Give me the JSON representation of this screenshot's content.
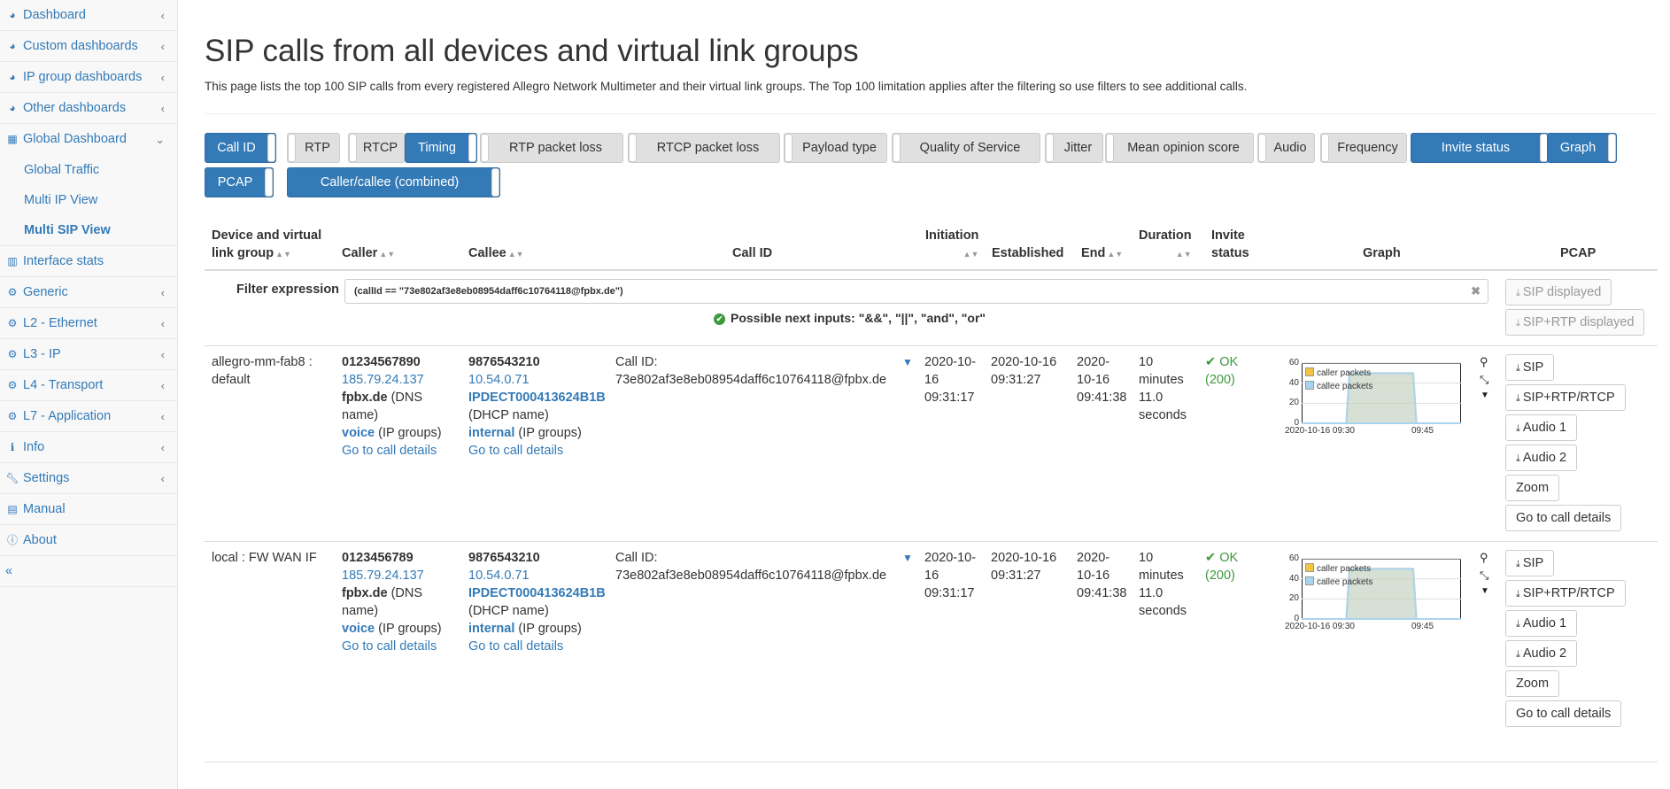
{
  "sidebar": {
    "items": [
      {
        "label": "Dashboard",
        "icon": "dashboard-icon"
      },
      {
        "label": "Custom dashboards",
        "icon": "dashboard-icon"
      },
      {
        "label": "IP group dashboards",
        "icon": "dashboard-icon"
      },
      {
        "label": "Other dashboards",
        "icon": "dashboard-icon"
      },
      {
        "label": "Global Dashboard",
        "icon": "grid-icon"
      }
    ],
    "global_sub": [
      "Global Traffic",
      "Multi IP View",
      "Multi SIP View"
    ],
    "items2": [
      {
        "label": "Interface stats",
        "icon": "bar-chart-icon"
      },
      {
        "label": "Generic",
        "icon": "gear-icon"
      },
      {
        "label": "L2 - Ethernet",
        "icon": "gear-icon"
      },
      {
        "label": "L3 - IP",
        "icon": "gear-icon"
      },
      {
        "label": "L4 - Transport",
        "icon": "gear-icon"
      },
      {
        "label": "L7 - Application",
        "icon": "gear-icon"
      },
      {
        "label": "Info",
        "icon": "info-icon"
      },
      {
        "label": "Settings",
        "icon": "wrench-icon"
      },
      {
        "label": "Manual",
        "icon": "book-icon"
      },
      {
        "label": "About",
        "icon": "info-circle-icon"
      }
    ],
    "collapse": "«"
  },
  "page": {
    "title": "SIP calls from all devices and virtual link groups",
    "description": "This page lists the top 100 SIP calls from every registered Allegro Network Multimeter and their virtual link groups. The Top 100 limitation applies after the filtering so use filters to see additional calls."
  },
  "toggles": [
    {
      "label": "Call ID",
      "on": true
    },
    {
      "label": "RTP",
      "on": false
    },
    {
      "label": "RTCP",
      "on": false
    },
    {
      "label": "Timing",
      "on": true
    },
    {
      "label": "RTP packet loss",
      "on": false
    },
    {
      "label": "RTCP packet loss",
      "on": false
    },
    {
      "label": "Payload type",
      "on": false
    },
    {
      "label": "Quality of Service",
      "on": false
    },
    {
      "label": "Jitter",
      "on": false
    },
    {
      "label": "Mean opinion score",
      "on": false
    },
    {
      "label": "Audio",
      "on": false
    },
    {
      "label": "Frequency",
      "on": false
    },
    {
      "label": "Invite status",
      "on": true
    },
    {
      "label": "Graph",
      "on": true
    },
    {
      "label": "PCAP",
      "on": true
    },
    {
      "label": "Caller/callee (combined)",
      "on": true
    }
  ],
  "table": {
    "headers": {
      "device_1": "Device and virtual",
      "device_2": "link group",
      "caller": "Caller",
      "callee": "Callee",
      "callid": "Call ID",
      "initiation": "Initiation",
      "established": "Established",
      "end": "End",
      "duration": "Duration",
      "invite_1": "Invite",
      "invite_2": "status",
      "graph": "Graph",
      "pcap": "PCAP"
    },
    "filter": {
      "label": "Filter expression",
      "value": "(callId == \"73e802af3e8eb08954daff6c10764118@fpbx.de\")",
      "hint": "Possible next inputs: \"&&\", \"||\", \"and\", \"or\"",
      "btn_sip": "SIP displayed",
      "btn_sip_rtp": "SIP+RTP displayed"
    },
    "rows": [
      {
        "device_1": "allegro-mm-fab8 :",
        "device_2": "default",
        "caller_number": "01234567890",
        "caller_ip": "185.79.24.137",
        "caller_dns": "fpbx.de",
        "caller_dns_suffix": " (DNS",
        "caller_dns_suffix2": "name)",
        "caller_group": "voice",
        "caller_group_suffix": " (IP groups)",
        "caller_details": "Go to call details",
        "callee_number": "9876543210",
        "callee_ip": "10.54.0.71",
        "callee_dhcp": "IPDECT000413624B1B",
        "callee_dhcp_suffix": "(DHCP name)",
        "callee_group": "internal",
        "callee_group_suffix": " (IP groups)",
        "callee_details": "Go to call details",
        "callid_label": "Call ID:",
        "callid": "73e802af3e8eb08954daff6c10764118@fpbx.de",
        "init_1": "2020-10-",
        "init_2": "16",
        "init_3": "09:31:17",
        "est_1": "2020-10-16",
        "est_2": "09:31:27",
        "end_1": "2020-",
        "end_2": "10-16",
        "end_3": "09:41:38",
        "dur_1": "10",
        "dur_2": "minutes",
        "dur_3": "11.0",
        "dur_4": "seconds",
        "status_1": "OK",
        "status_2": "(200)"
      },
      {
        "device_1": "local : FW WAN IF",
        "device_2": "",
        "caller_number": "0123456789",
        "caller_ip": "185.79.24.137",
        "caller_dns": "fpbx.de",
        "caller_dns_suffix": " (DNS",
        "caller_dns_suffix2": "name)",
        "caller_group": "voice",
        "caller_group_suffix": " (IP groups)",
        "caller_details": "Go to call details",
        "callee_number": "9876543210",
        "callee_ip": "10.54.0.71",
        "callee_dhcp": "IPDECT000413624B1B",
        "callee_dhcp_suffix": "(DHCP name)",
        "callee_group": "internal",
        "callee_group_suffix": " (IP groups)",
        "callee_details": "Go to call details",
        "callid_label": "Call ID:",
        "callid": "73e802af3e8eb08954daff6c10764118@fpbx.de",
        "init_1": "2020-10-",
        "init_2": "16",
        "init_3": "09:31:17",
        "est_1": "2020-10-16",
        "est_2": "09:31:27",
        "end_1": "2020-",
        "end_2": "10-16",
        "end_3": "09:41:38",
        "dur_1": "10",
        "dur_2": "minutes",
        "dur_3": "11.0",
        "dur_4": "seconds",
        "status_1": "OK",
        "status_2": "(200)"
      }
    ],
    "pcap_buttons": {
      "sip": "SIP",
      "sip_rtp": "SIP+RTP/RTCP",
      "audio1": "Audio 1",
      "audio2": "Audio 2",
      "zoom": "Zoom",
      "details": "Go to call details"
    }
  },
  "chart_data": [
    {
      "type": "area",
      "x": [
        "2020-10-16 09:30",
        "09:45"
      ],
      "ylim": [
        0,
        60
      ],
      "yticks": [
        0,
        20,
        40,
        60
      ],
      "series": [
        {
          "name": "caller packets",
          "color": "#f5c242",
          "values": [
            0,
            0,
            50,
            50,
            0
          ]
        },
        {
          "name": "callee packets",
          "color": "#a9d4f0",
          "values": [
            0,
            0,
            50,
            50,
            0
          ]
        }
      ]
    },
    {
      "type": "area",
      "x": [
        "2020-10-16 09:30",
        "09:45"
      ],
      "ylim": [
        0,
        60
      ],
      "yticks": [
        0,
        20,
        40,
        60
      ],
      "series": [
        {
          "name": "caller packets",
          "color": "#f5c242",
          "values": [
            0,
            0,
            50,
            50,
            0
          ]
        },
        {
          "name": "callee packets",
          "color": "#a9d4f0",
          "values": [
            0,
            0,
            50,
            50,
            0
          ]
        }
      ]
    }
  ]
}
